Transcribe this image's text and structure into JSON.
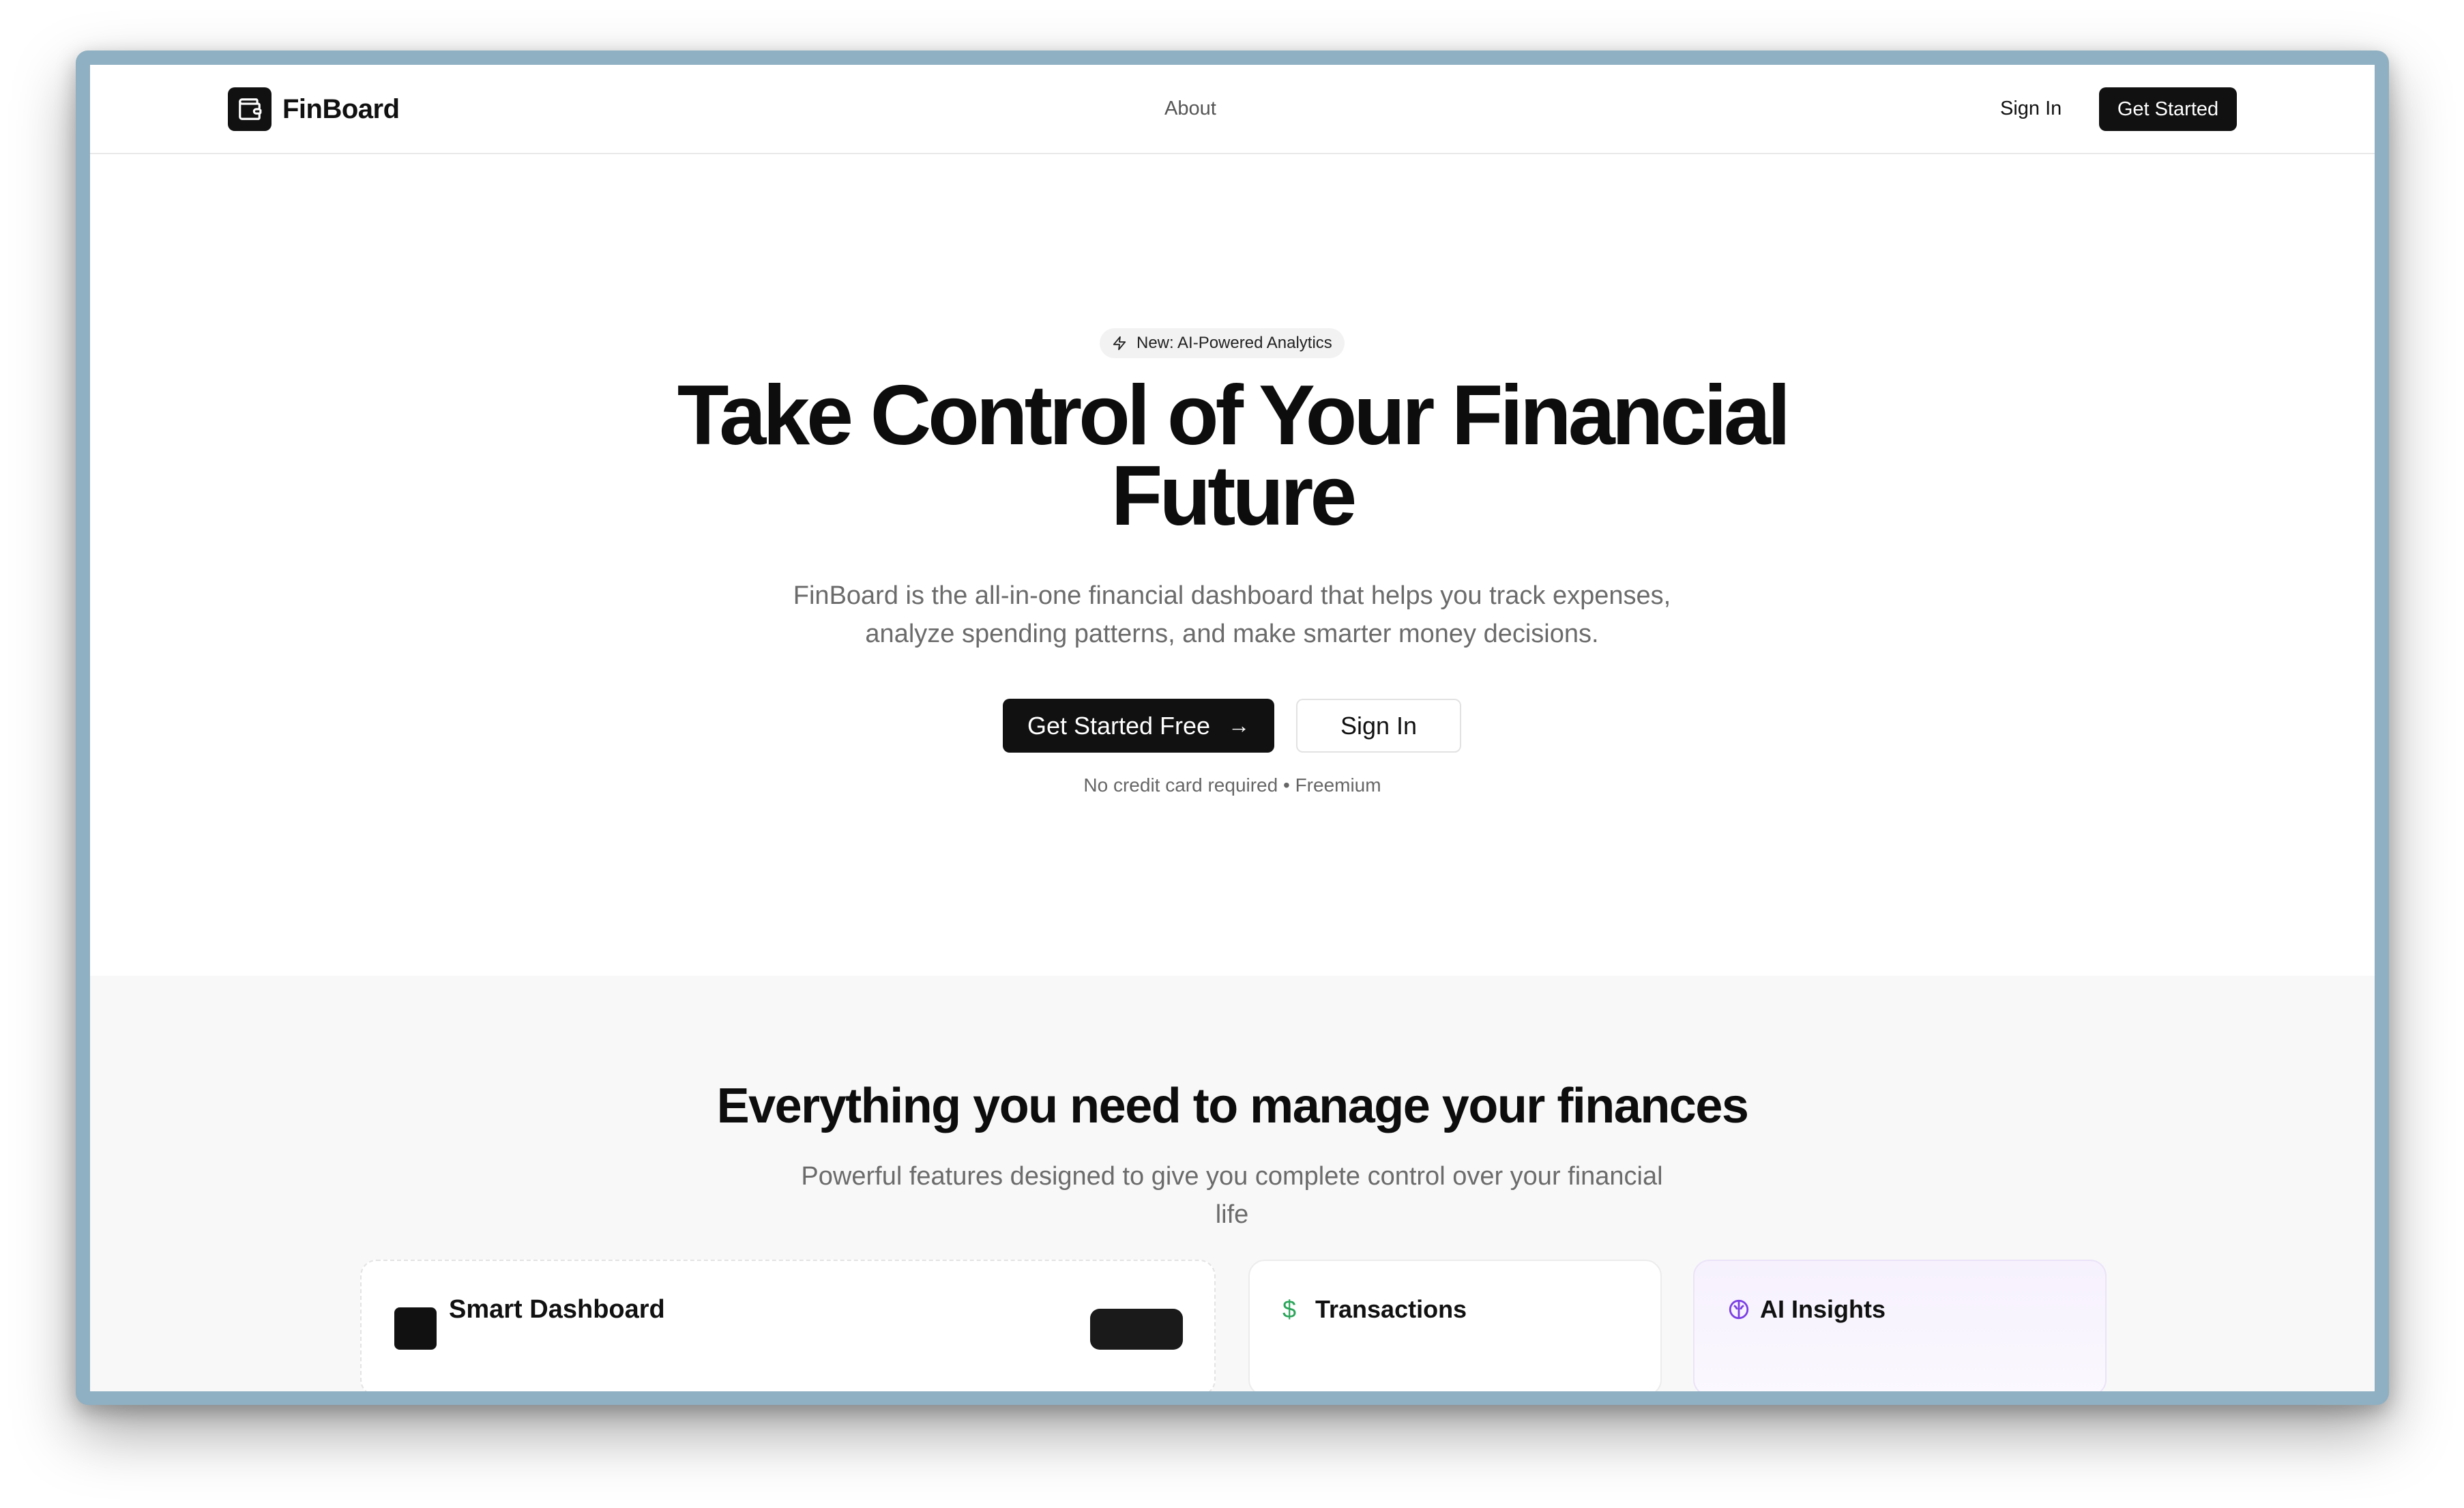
{
  "nav": {
    "brand": "FinBoard",
    "links": [
      "About"
    ],
    "sign_in": "Sign In",
    "cta": "Get Started"
  },
  "hero": {
    "badge": "New: AI-Powered Analytics",
    "title_line1": "Take Control of Your Financial",
    "title_line2": "Future",
    "subtitle_line1": "FinBoard is the all-in-one financial dashboard that helps you track expenses,",
    "subtitle_line2": "analyze spending patterns, and make smarter money decisions.",
    "primary_button": "Get Started Free",
    "secondary_button": "Sign In",
    "fine_print": "No credit card required • Freemium"
  },
  "features": {
    "title": "Everything you need to manage your finances",
    "subtitle_line1": "Powerful features designed to give you complete control over your financial",
    "subtitle_line2": "life",
    "cards": [
      {
        "title": "Smart Dashboard"
      },
      {
        "title": "Transactions",
        "icon": "dollar-icon"
      },
      {
        "title": "AI Insights",
        "icon": "brain-icon"
      }
    ]
  },
  "colors": {
    "primary": "#111111",
    "muted_text": "#6b6b6b",
    "section_bg": "#f8f8f8",
    "accent_green": "#2aa55a",
    "accent_purple": "#7b3fe4"
  }
}
